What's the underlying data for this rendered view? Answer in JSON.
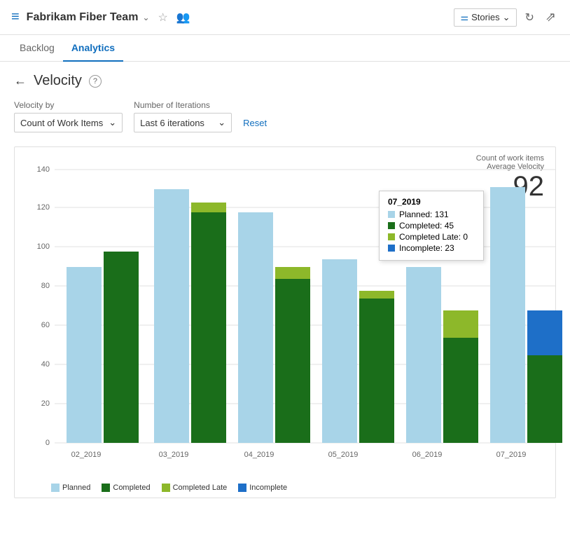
{
  "header": {
    "icon": "≡",
    "title": "Fabrikam Fiber Team",
    "chevron": "∨",
    "star": "☆",
    "team_icon": "👥"
  },
  "nav": {
    "tabs": [
      {
        "label": "Backlog",
        "active": false
      },
      {
        "label": "Analytics",
        "active": true
      }
    ],
    "stories_btn": "Stories",
    "refresh_icon": "↻",
    "expand_icon": "⤢"
  },
  "page": {
    "back_icon": "←",
    "title": "Velocity",
    "help_icon": "?"
  },
  "filters": {
    "velocity_by_label": "Velocity by",
    "velocity_by_value": "Count of Work Items",
    "iterations_label": "Number of Iterations",
    "iterations_value": "Last 6 iterations",
    "reset_label": "Reset"
  },
  "chart": {
    "metric_label1": "Count of work items",
    "metric_label2": "Average Velocity",
    "metric_value": "92",
    "y_axis": [
      0,
      20,
      40,
      60,
      80,
      100,
      120,
      140
    ],
    "bars": [
      {
        "label": "02_2019",
        "planned": 90,
        "completed": 98,
        "completed_late": 0,
        "incomplete": 0
      },
      {
        "label": "03_2019",
        "planned": 130,
        "completed": 118,
        "completed_late": 0,
        "incomplete": 0
      },
      {
        "label": "04_2019",
        "planned": 118,
        "completed": 84,
        "completed_late": 6,
        "incomplete": 0
      },
      {
        "label": "05_2019",
        "planned": 94,
        "completed": 74,
        "completed_late": 4,
        "incomplete": 0
      },
      {
        "label": "06_2019",
        "planned": 90,
        "completed": 54,
        "completed_late": 14,
        "incomplete": 0
      },
      {
        "label": "07_2019",
        "planned": 131,
        "completed": 45,
        "completed_late": 0,
        "incomplete": 23
      }
    ],
    "tooltip": {
      "title": "07_2019",
      "rows": [
        {
          "label": "Planned: 131",
          "color": "#a8d4e8"
        },
        {
          "label": "Completed: 45",
          "color": "#1a6e1a"
        },
        {
          "label": "Completed Late: 0",
          "color": "#8db82a"
        },
        {
          "label": "Incomplete: 23",
          "color": "#1e6fc8"
        }
      ]
    },
    "legend": [
      {
        "label": "Planned",
        "color": "#a8d4e8"
      },
      {
        "label": "Completed",
        "color": "#1a6e1a"
      },
      {
        "label": "Completed Late",
        "color": "#8db82a"
      },
      {
        "label": "Incomplete",
        "color": "#1e6fc8"
      }
    ]
  }
}
